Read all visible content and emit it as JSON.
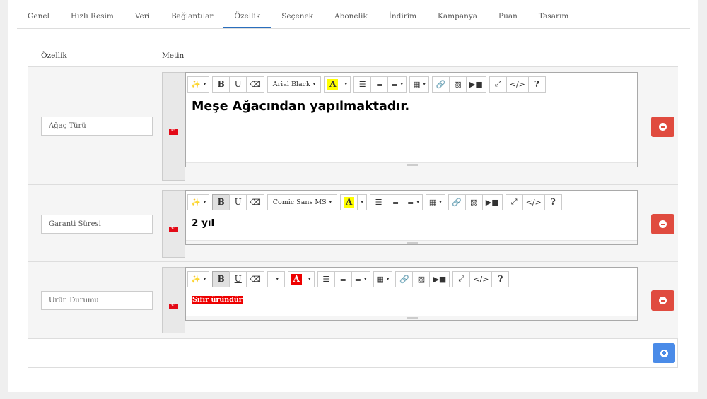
{
  "tabs": [
    {
      "label": "Genel"
    },
    {
      "label": "Hızlı Resim"
    },
    {
      "label": "Veri"
    },
    {
      "label": "Bağlantılar"
    },
    {
      "label": "Özellik",
      "active": true
    },
    {
      "label": "Seçenek"
    },
    {
      "label": "Abonelik"
    },
    {
      "label": "İndirim"
    },
    {
      "label": "Kampanya"
    },
    {
      "label": "Puan"
    },
    {
      "label": "Tasarım"
    }
  ],
  "columns": {
    "feature": "Özellik",
    "text": "Metin"
  },
  "rows": [
    {
      "name": "Ağaç Türü",
      "font": "Arial Black",
      "text": "Meşe Ağacından yapılmaktadır."
    },
    {
      "name": "Garanti Süresi",
      "font": "Comic Sans MS",
      "text": "2 yıl"
    },
    {
      "name": "Ürün Durumu",
      "font": "",
      "text": "Sıfır üründür"
    }
  ],
  "toolbar": {
    "magic": "magic-wand-icon",
    "bold": "B",
    "underline": "U",
    "help": "?",
    "highlight_letter": "A",
    "code": "</>"
  },
  "colors": {
    "accent": "#2a6ebd",
    "delete": "#e04b3f",
    "add": "#4a8be8",
    "highlight": "#ffff00",
    "text_red_bg": "#e00000"
  }
}
